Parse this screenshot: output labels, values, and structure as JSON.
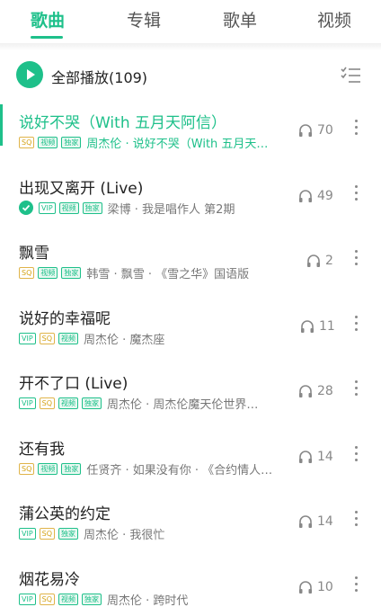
{
  "tabs": [
    {
      "label": "歌曲",
      "active": true
    },
    {
      "label": "专辑",
      "active": false
    },
    {
      "label": "歌单",
      "active": false
    },
    {
      "label": "视频",
      "active": false
    }
  ],
  "play_all": {
    "label": "全部播放",
    "count": "(109)"
  },
  "colors": {
    "accent": "#1ec08a",
    "sq": "#d4a215"
  },
  "songs": [
    {
      "title": "说好不哭（With 五月天阿信）",
      "badges": [
        "SQ",
        "视频",
        "独家"
      ],
      "artist": "周杰伦 · 说好不哭（With 五月天…",
      "listens": "70",
      "playing": true,
      "downloaded": false
    },
    {
      "title": "出现又离开 (Live)",
      "badges": [
        "VIP",
        "视频",
        "独家"
      ],
      "artist": "梁博 · 我是唱作人 第2期",
      "listens": "49",
      "playing": false,
      "downloaded": true
    },
    {
      "title": "飘雪",
      "badges": [
        "SQ",
        "视频",
        "独家"
      ],
      "artist": "韩雪 · 飘雪 · 《雪之华》国语版",
      "listens": "2",
      "playing": false,
      "downloaded": false
    },
    {
      "title": "说好的幸福呢",
      "badges": [
        "VIP",
        "SQ",
        "视频"
      ],
      "artist": "周杰伦 · 魔杰座",
      "listens": "11",
      "playing": false,
      "downloaded": false
    },
    {
      "title": "开不了口 (Live)",
      "badges": [
        "VIP",
        "SQ",
        "视频",
        "独家"
      ],
      "artist": "周杰伦 · 周杰伦魔天伦世界…",
      "listens": "28",
      "playing": false,
      "downloaded": false
    },
    {
      "title": "还有我",
      "badges": [
        "SQ",
        "视频",
        "独家"
      ],
      "artist": "任贤齐 · 如果没有你 · 《合约情人…",
      "listens": "14",
      "playing": false,
      "downloaded": false
    },
    {
      "title": "蒲公英的约定",
      "badges": [
        "VIP",
        "SQ",
        "独家"
      ],
      "artist": "周杰伦 · 我很忙",
      "listens": "14",
      "playing": false,
      "downloaded": false
    },
    {
      "title": "烟花易冷",
      "badges": [
        "VIP",
        "SQ",
        "视频",
        "独家"
      ],
      "artist": "周杰伦 · 跨时代",
      "listens": "10",
      "playing": false,
      "downloaded": false
    }
  ],
  "icons": {
    "play": "play-icon",
    "manage": "list-manage-icon",
    "listen": "headphones-icon",
    "more": "more-vertical-icon",
    "check": "check-icon"
  }
}
